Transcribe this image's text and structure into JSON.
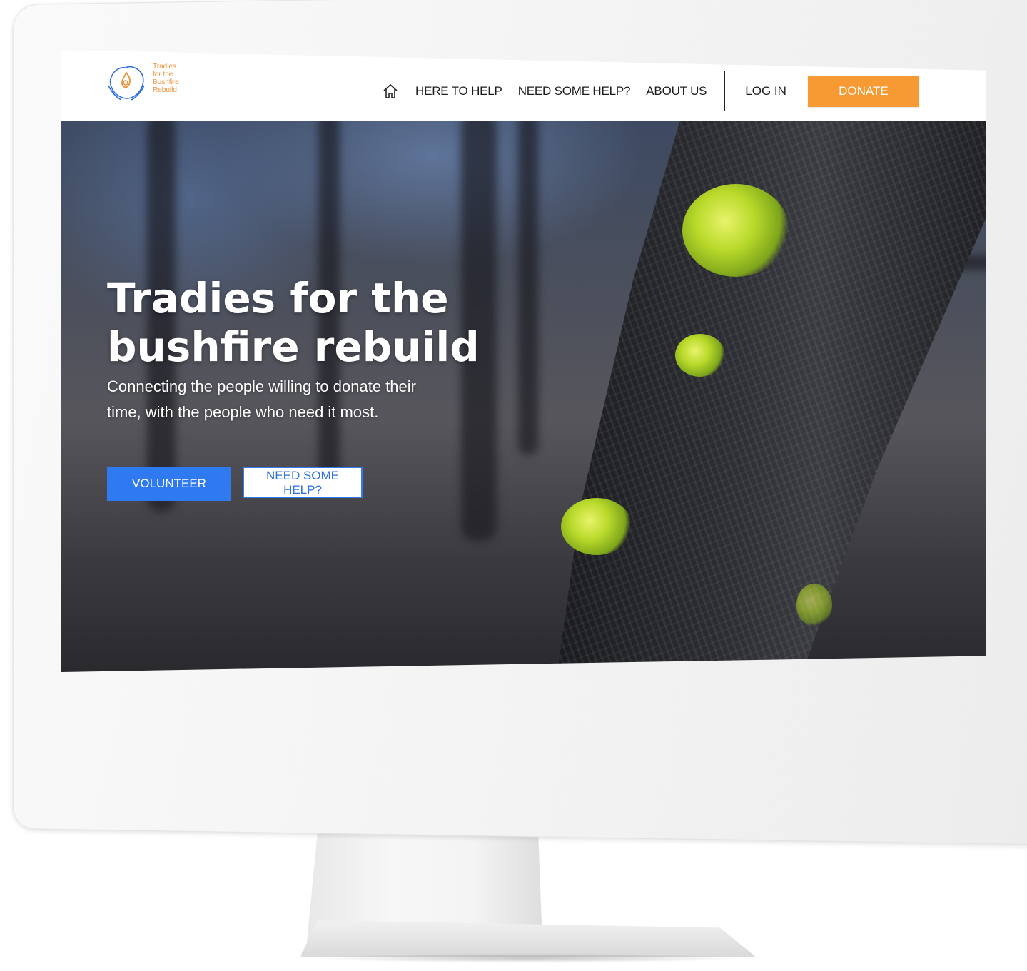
{
  "logo": {
    "lines": [
      "Tradies",
      "for the",
      "Bushfire",
      "Rebuild"
    ],
    "icon": "australia-hands-flame-icon"
  },
  "nav": {
    "home_icon": "home-icon",
    "items": [
      {
        "label": "HERE TO HELP"
      },
      {
        "label": "NEED SOME HELP?"
      },
      {
        "label": "ABOUT US"
      }
    ],
    "login_label": "LOG IN",
    "donate_label": "DONATE"
  },
  "hero": {
    "title_lines": [
      "Tradies for the",
      "bushfire rebuild"
    ],
    "subtitle_lines": [
      "Connecting the people willing to donate their",
      "time, with the people who need it most."
    ],
    "primary_button": "VOLUNTEER",
    "secondary_button": "NEED SOME HELP?"
  },
  "colors": {
    "accent_orange": "#f89a33",
    "primary_blue": "#2f7af0",
    "logo_blue": "#2f6fe0",
    "logo_orange": "#f0913a"
  }
}
